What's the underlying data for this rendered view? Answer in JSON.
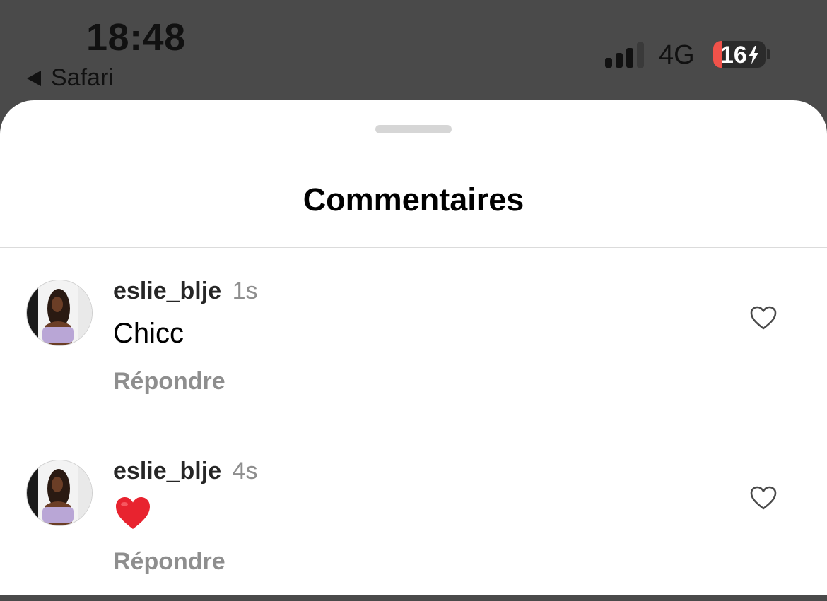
{
  "status_bar": {
    "time": "18:48",
    "back_label": "Safari",
    "network": "4G",
    "battery_level": "16",
    "battery_percent": 16,
    "signal_bars_active": 3,
    "signal_bars_total": 4
  },
  "sheet": {
    "title": "Commentaires"
  },
  "comments": [
    {
      "username": "eslie_blje",
      "time": "1s",
      "text": "Chicc",
      "reply_label": "Répondre"
    },
    {
      "username": "eslie_blje",
      "time": "4s",
      "emoji": "red-heart",
      "reply_label": "Répondre"
    }
  ],
  "icons": {
    "back": "back-arrow-icon",
    "signal": "cellular-signal-icon",
    "battery": "battery-charging-icon",
    "like": "heart-outline-icon",
    "emoji": "red-heart-emoji"
  },
  "colors": {
    "status_bar_bg": "#4a4a4a",
    "battery_low": "#f0524a",
    "muted_text": "#8e8e8e",
    "heart_red": "#e0245e"
  }
}
